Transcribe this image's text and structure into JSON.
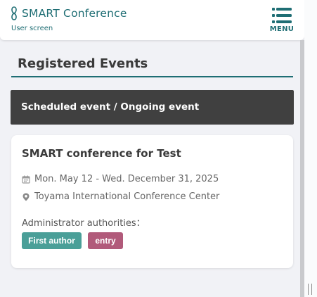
{
  "header": {
    "app_title": "SMART Conference",
    "subtitle": "User screen",
    "menu_label": "MENU",
    "logo_icon": "smart-logo-icon",
    "menu_icon": "hamburger-icon",
    "brand_color": "#1f6e74"
  },
  "main": {
    "section_title": "Registered Events",
    "event_status_band": "Scheduled event / Ongoing event",
    "events": [
      {
        "title": "SMART conference for Test",
        "date_range": "Mon. May 12 - Wed. December 31, 2025",
        "venue": "Toyama International Conference Center",
        "admin_label": "Administrator authorities：",
        "badges": [
          {
            "label": "First author",
            "color": "#4a9f98"
          },
          {
            "label": "entry",
            "color": "#b15a7a"
          }
        ],
        "date_icon": "calendar-icon",
        "venue_icon": "location-pin-icon"
      }
    ]
  }
}
